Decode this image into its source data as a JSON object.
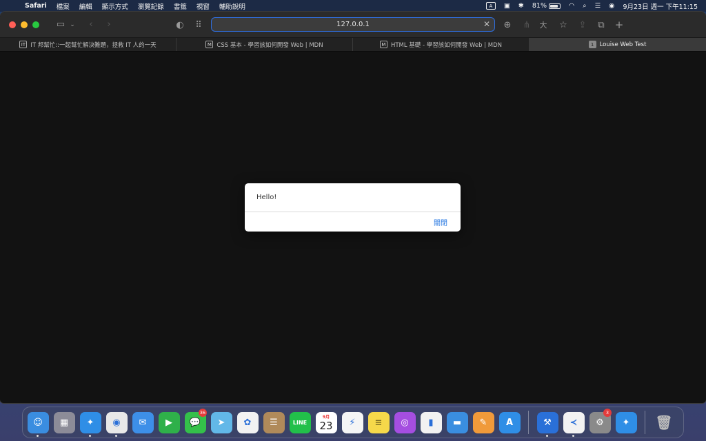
{
  "menubar": {
    "app_name": "Safari",
    "items": [
      "檔案",
      "編輯",
      "顯示方式",
      "瀏覽記錄",
      "書籤",
      "視窗",
      "輔助說明"
    ],
    "input_indicator": "A",
    "battery_percent": "81%",
    "battery_level": 0.81,
    "datetime": "9月23日 週一 下午11:15"
  },
  "browser": {
    "url": "127.0.0.1",
    "tabs": [
      {
        "label": "IT 邦幫忙::一起幫忙解決難題，拯救 IT 人的一天",
        "favicon": "IT",
        "active": false
      },
      {
        "label": "CSS 基本 - 學習該如何開發 Web | MDN",
        "favicon": "M",
        "active": false
      },
      {
        "label": "HTML 基礎 - 學習該如何開發 Web | MDN",
        "favicon": "M",
        "active": false
      },
      {
        "label": "Louise Web Test",
        "favicon": "1",
        "active": true
      }
    ]
  },
  "alert": {
    "message": "Hello!",
    "close_label": "關閉"
  },
  "dock": {
    "apps": [
      {
        "name": "finder",
        "color": "#3a8de0",
        "glyph": "☺",
        "running": true
      },
      {
        "name": "launchpad",
        "color": "#8c8c98",
        "glyph": "▦",
        "running": false
      },
      {
        "name": "safari",
        "color": "#2f8ee6",
        "glyph": "✦",
        "running": true
      },
      {
        "name": "chrome",
        "color": "#e8e8e8",
        "glyph": "◉",
        "running": true
      },
      {
        "name": "mail",
        "color": "#3d8fe8",
        "glyph": "✉",
        "running": false
      },
      {
        "name": "facetime",
        "color": "#2fb04a",
        "glyph": "▶",
        "running": false
      },
      {
        "name": "messages",
        "color": "#34c04a",
        "glyph": "💬",
        "running": false,
        "badge": "36"
      },
      {
        "name": "maps",
        "color": "#62b8e8",
        "glyph": "➤",
        "running": false
      },
      {
        "name": "photos",
        "color": "#f2f2f2",
        "glyph": "✿",
        "running": false
      },
      {
        "name": "contacts",
        "color": "#b08a5a",
        "glyph": "☰",
        "running": false
      },
      {
        "name": "line",
        "color": "#22c04a",
        "glyph": "LINE",
        "running": false
      },
      {
        "name": "calendar",
        "month": "9月",
        "day": "23",
        "running": false
      },
      {
        "name": "messenger",
        "color": "#f5f5f5",
        "glyph": "⚡",
        "running": false
      },
      {
        "name": "notes",
        "color": "#f6d84a",
        "glyph": "≡",
        "running": false
      },
      {
        "name": "podcasts",
        "color": "#a54ee0",
        "glyph": "◎",
        "running": false
      },
      {
        "name": "numbers",
        "color": "#f2f2f2",
        "glyph": "▮",
        "running": false
      },
      {
        "name": "keynote",
        "color": "#3a8ee0",
        "glyph": "▬",
        "running": false
      },
      {
        "name": "pages",
        "color": "#f09a3a",
        "glyph": "✎",
        "running": false
      },
      {
        "name": "app-store",
        "color": "#2f8ee6",
        "glyph": "A",
        "running": false
      },
      {
        "name": "xcode",
        "color": "#2a70d8",
        "glyph": "⚒",
        "running": true
      },
      {
        "name": "vscode",
        "color": "#f2f2f2",
        "glyph": "≺",
        "running": true
      },
      {
        "name": "system-preferences",
        "color": "#8a8a8a",
        "glyph": "⚙",
        "running": false,
        "badge": "3"
      },
      {
        "name": "safari-downloads",
        "color": "#2f8ee6",
        "glyph": "✦",
        "running": false
      },
      {
        "name": "trash",
        "color": "transparent",
        "glyph": "🗑",
        "running": false
      }
    ]
  }
}
